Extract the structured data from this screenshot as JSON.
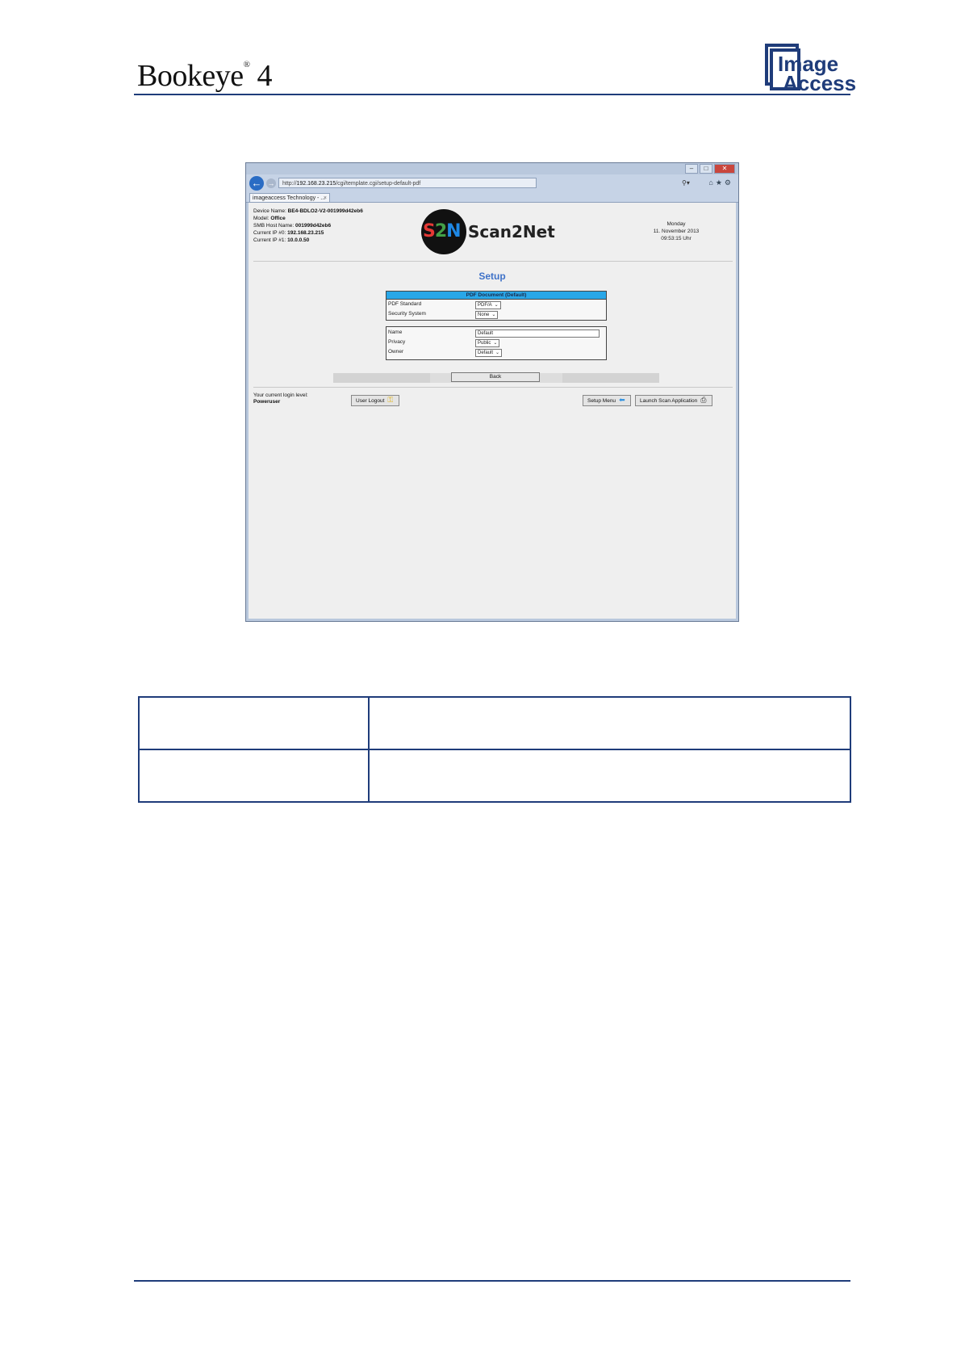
{
  "header": {
    "brand": "Bookeye",
    "brand_mark": "®",
    "brand_number": "4",
    "logo_line1": "Image",
    "logo_line2": "Access"
  },
  "browser": {
    "url_prefix": "http://",
    "url_host": "192.168.23.215",
    "url_path": "/cgi/template.cgi/setup-default-pdf",
    "tab_title": "imageaccess Technology - ...",
    "tab_close": "×",
    "back_icon": "arrow-left-icon",
    "window_buttons": [
      "–",
      "□",
      "✕"
    ]
  },
  "device": {
    "name_label": "Device Name:",
    "name_value": "BE4-BDLO2-V2-001999d42eb6",
    "model_label": "Model:",
    "model_value": "Office",
    "smb_label": "SMB Host Name:",
    "smb_value": "001999d42eb6",
    "ip0_label": "Current IP #0:",
    "ip0_value": "192.168.23.215",
    "ip1_label": "Current IP #1:",
    "ip1_value": "10.0.0.50"
  },
  "app_logo": {
    "word": "Scan2Net"
  },
  "datetime": {
    "weekday": "Monday",
    "date": "11. November 2013",
    "time": "09:53:15 Uhr"
  },
  "page_title": "Setup",
  "pdf_panel": {
    "header": "PDF Document (Default)",
    "pdf_standard_label": "PDF Standard",
    "pdf_standard_value": "PDF/A",
    "security_label": "Security System",
    "security_value": "None"
  },
  "profile_panel": {
    "name_label": "Name",
    "name_value": "Default",
    "privacy_label": "Privacy",
    "privacy_value": "Public",
    "owner_label": "Owner",
    "owner_value": "Default"
  },
  "buttons": {
    "back": "Back",
    "user_logout": "User Logout",
    "setup_menu": "Setup Menu",
    "launch_scan": "Launch Scan Application"
  },
  "login": {
    "label": "Your current login level:",
    "level": "Poweruser"
  },
  "colors": {
    "accent_blue": "#1f3c7a",
    "panel_header": "#29a7e8",
    "setup_title": "#3f72c8"
  }
}
